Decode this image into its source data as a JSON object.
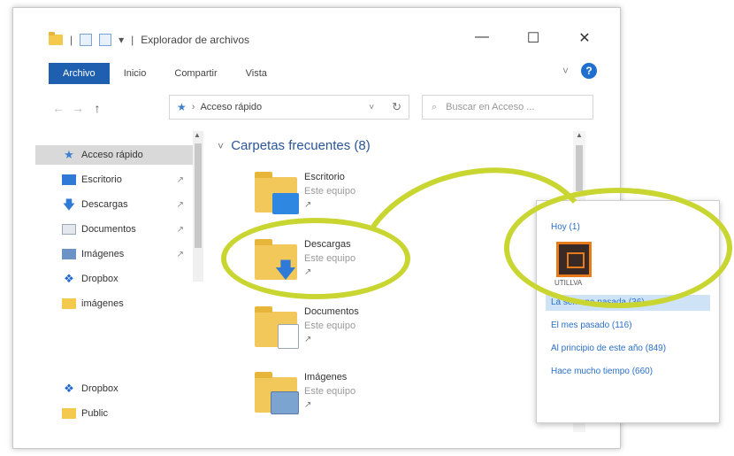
{
  "window": {
    "title": "Explorador de archivos",
    "quick_access_sep": "|",
    "quick_access_arrow": "▾",
    "controls": {
      "minimize": "—",
      "maximize": "☐",
      "close": "✕"
    }
  },
  "ribbon": {
    "tabs": [
      {
        "label": "Archivo",
        "active": true
      },
      {
        "label": "Inicio"
      },
      {
        "label": "Compartir"
      },
      {
        "label": "Vista"
      }
    ],
    "expand": "˅",
    "help": "?"
  },
  "nav": {
    "back": "←",
    "forward": "→",
    "up": "↑",
    "address": {
      "pin": "★",
      "sep": "›",
      "path": "Acceso rápido",
      "dropdown": "˅",
      "refresh": "↻"
    },
    "search": {
      "icon": "⌕",
      "placeholder": "Buscar en Acceso ..."
    }
  },
  "sidebar": {
    "items": [
      {
        "label": "Acceso rápido",
        "icon": "star-icon",
        "selected": true
      },
      {
        "label": "Escritorio",
        "icon": "desktop-icon",
        "pinned": true
      },
      {
        "label": "Descargas",
        "icon": "download-icon",
        "pinned": true
      },
      {
        "label": "Documentos",
        "icon": "document-icon",
        "pinned": true
      },
      {
        "label": "Imágenes",
        "icon": "pictures-icon",
        "pinned": true
      },
      {
        "label": "Dropbox",
        "icon": "dropbox-icon"
      },
      {
        "label": "imágenes",
        "icon": "folder-icon"
      },
      {
        "label": "Dropbox",
        "icon": "dropbox-icon"
      },
      {
        "label": "Public",
        "icon": "folder-icon"
      }
    ],
    "pin_glyph": "↗"
  },
  "content": {
    "section": {
      "caret": "˅",
      "title": "Carpetas frecuentes (8)"
    },
    "folders": [
      {
        "name": "Escritorio",
        "location": "Este equipo",
        "pin": "↗"
      },
      {
        "name": "Descargas",
        "location": "Este equipo",
        "pin": "↗"
      },
      {
        "name": "Documentos",
        "location": "Este equipo",
        "pin": "↗"
      },
      {
        "name": "Imágenes",
        "location": "Este equipo",
        "pin": "↗"
      }
    ]
  },
  "popup": {
    "today": "Hoy (1)",
    "app_label": "UTILLVA",
    "rows": [
      {
        "label": "La semana pasada (36)",
        "selected": true
      },
      {
        "label": "El mes pasado (116)"
      },
      {
        "label": "Al principio de este año (849)"
      },
      {
        "label": "Hace mucho tiempo (660)"
      }
    ]
  },
  "colors": {
    "accent": "#1f5fb0",
    "highlight": "#c9d530",
    "popup_link": "#2a6fc9"
  }
}
